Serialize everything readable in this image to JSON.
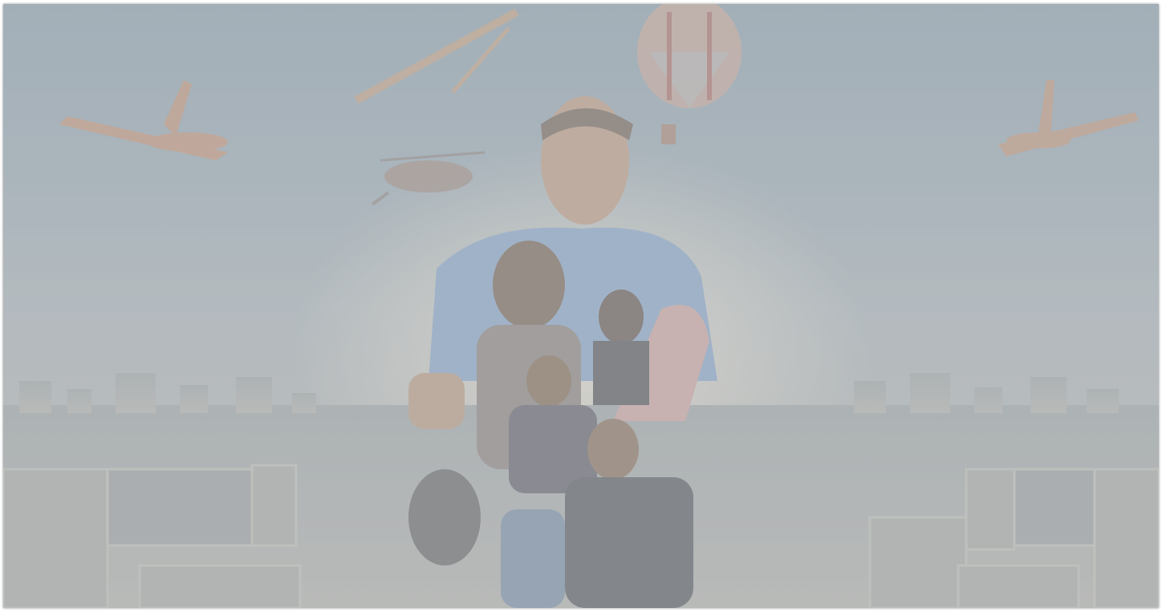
{
  "backdrop": {
    "description_icon": "movie-poster-backdrop",
    "overlay_color": "#c8cdd2",
    "sky_color": "#8f9fab",
    "city_color": "#a7a9a8",
    "accent_colors": [
      "#c99a7a",
      "#8aa7c9",
      "#b98b6a"
    ]
  }
}
